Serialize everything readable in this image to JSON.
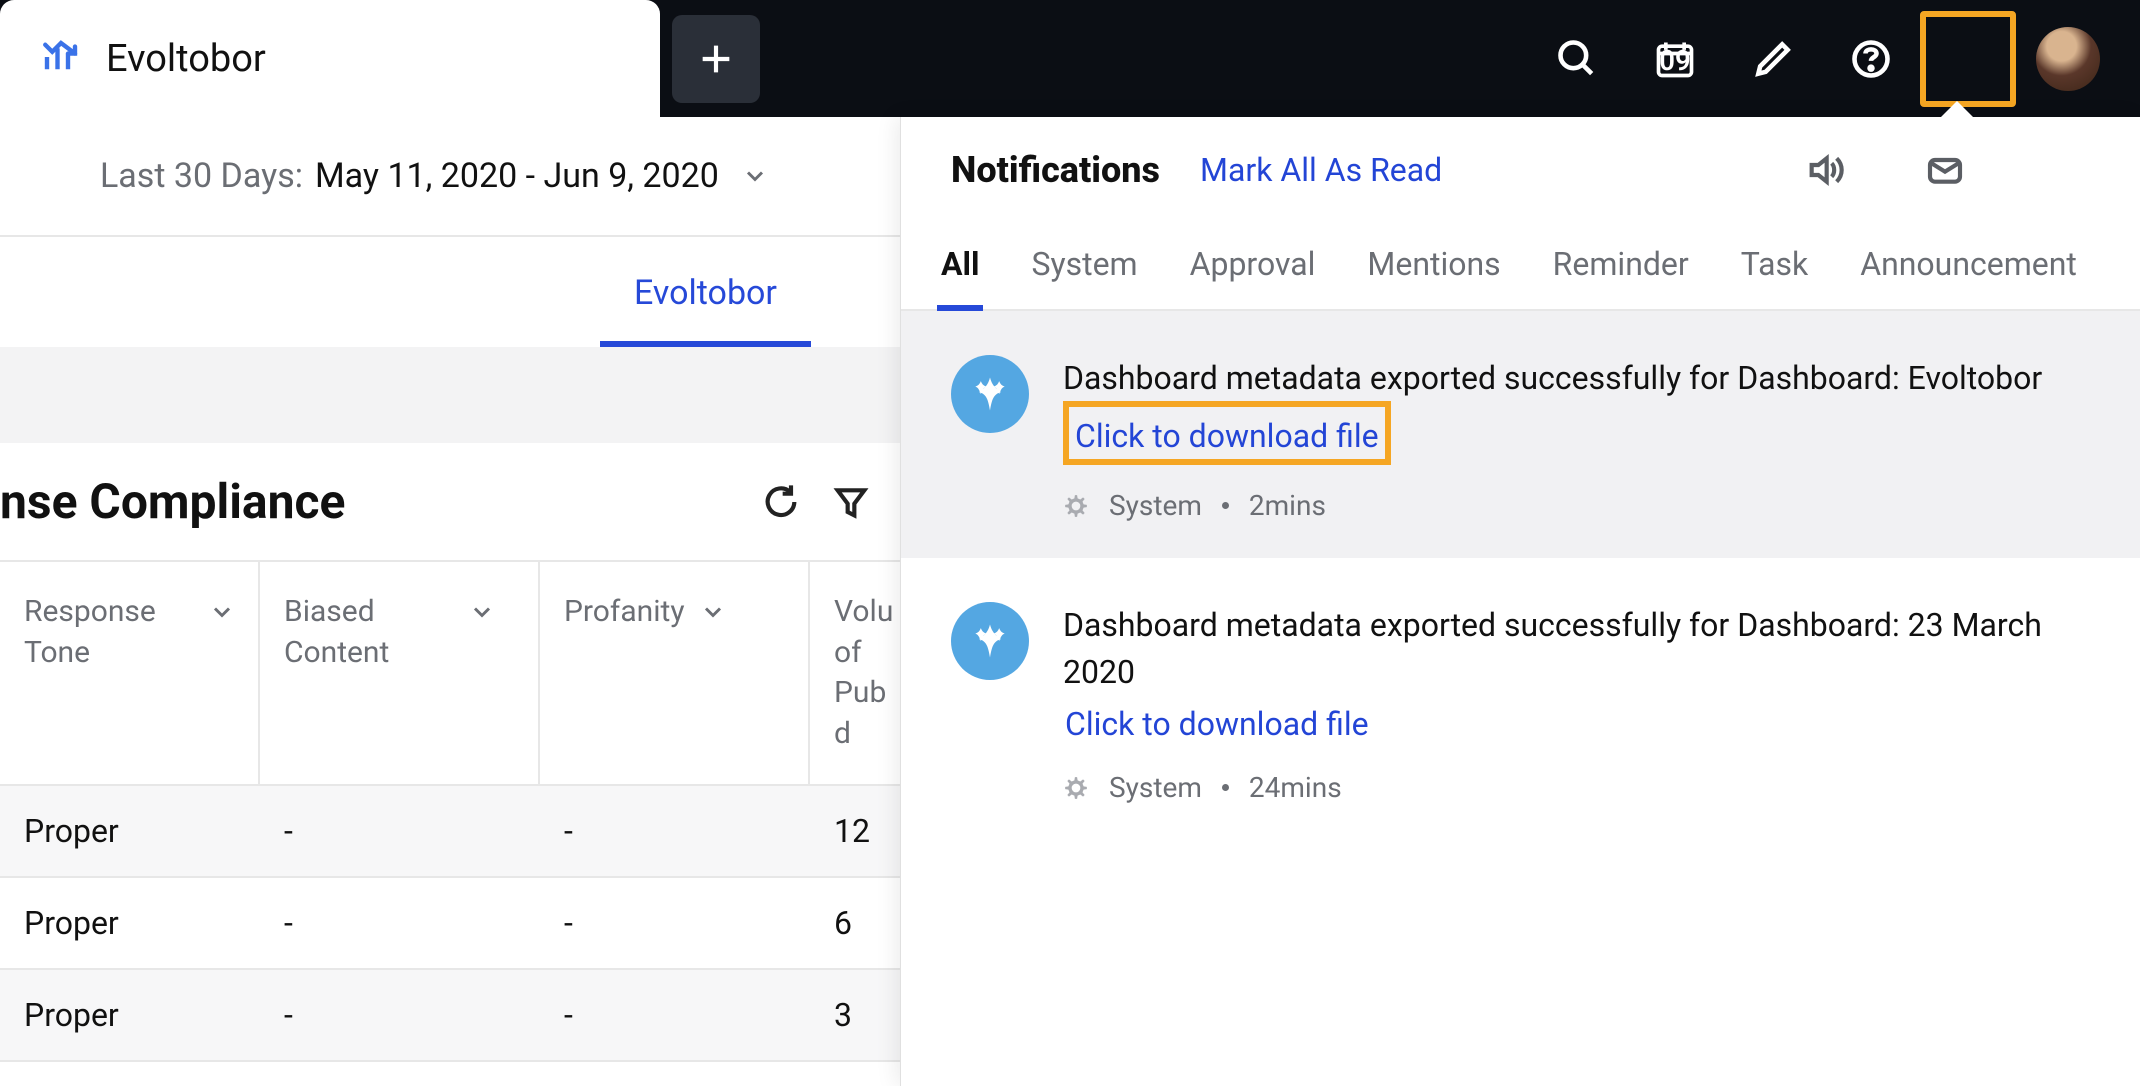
{
  "topbar": {
    "tab_title": "Evoltobor",
    "calendar_day": "09"
  },
  "date_range": {
    "prefix": "Last 30 Days:",
    "range": "May 11, 2020 - Jun 9, 2020"
  },
  "subtabs": {
    "active": "Evoltobor"
  },
  "card": {
    "title": "nse Compliance"
  },
  "table": {
    "headers": {
      "c1": "Response Tone",
      "c2": "Biased Content",
      "c3": "Profanity",
      "c4": "Volu of Pub d"
    },
    "rows": [
      {
        "c1": "Proper",
        "c2": "-",
        "c3": "-",
        "c4": "12"
      },
      {
        "c1": "Proper",
        "c2": "-",
        "c3": "-",
        "c4": "6"
      },
      {
        "c1": "Proper",
        "c2": "-",
        "c3": "-",
        "c4": "3"
      }
    ]
  },
  "panel": {
    "title": "Notifications",
    "mark_read": "Mark All As Read",
    "tabs": [
      "All",
      "System",
      "Approval",
      "Mentions",
      "Reminder",
      "Task",
      "Announcement"
    ],
    "selected_tab": "All",
    "items": [
      {
        "text": "Dashboard metadata exported successfully for Dashboard: Evoltobor",
        "link": "Click to download file",
        "category": "System",
        "time": "2mins",
        "highlighted": true,
        "link_highlighted": true
      },
      {
        "text": "Dashboard metadata exported successfully for Dashboard: 23 March 2020",
        "link": "Click to download file",
        "category": "System",
        "time": "24mins",
        "highlighted": false,
        "link_highlighted": false
      }
    ]
  }
}
